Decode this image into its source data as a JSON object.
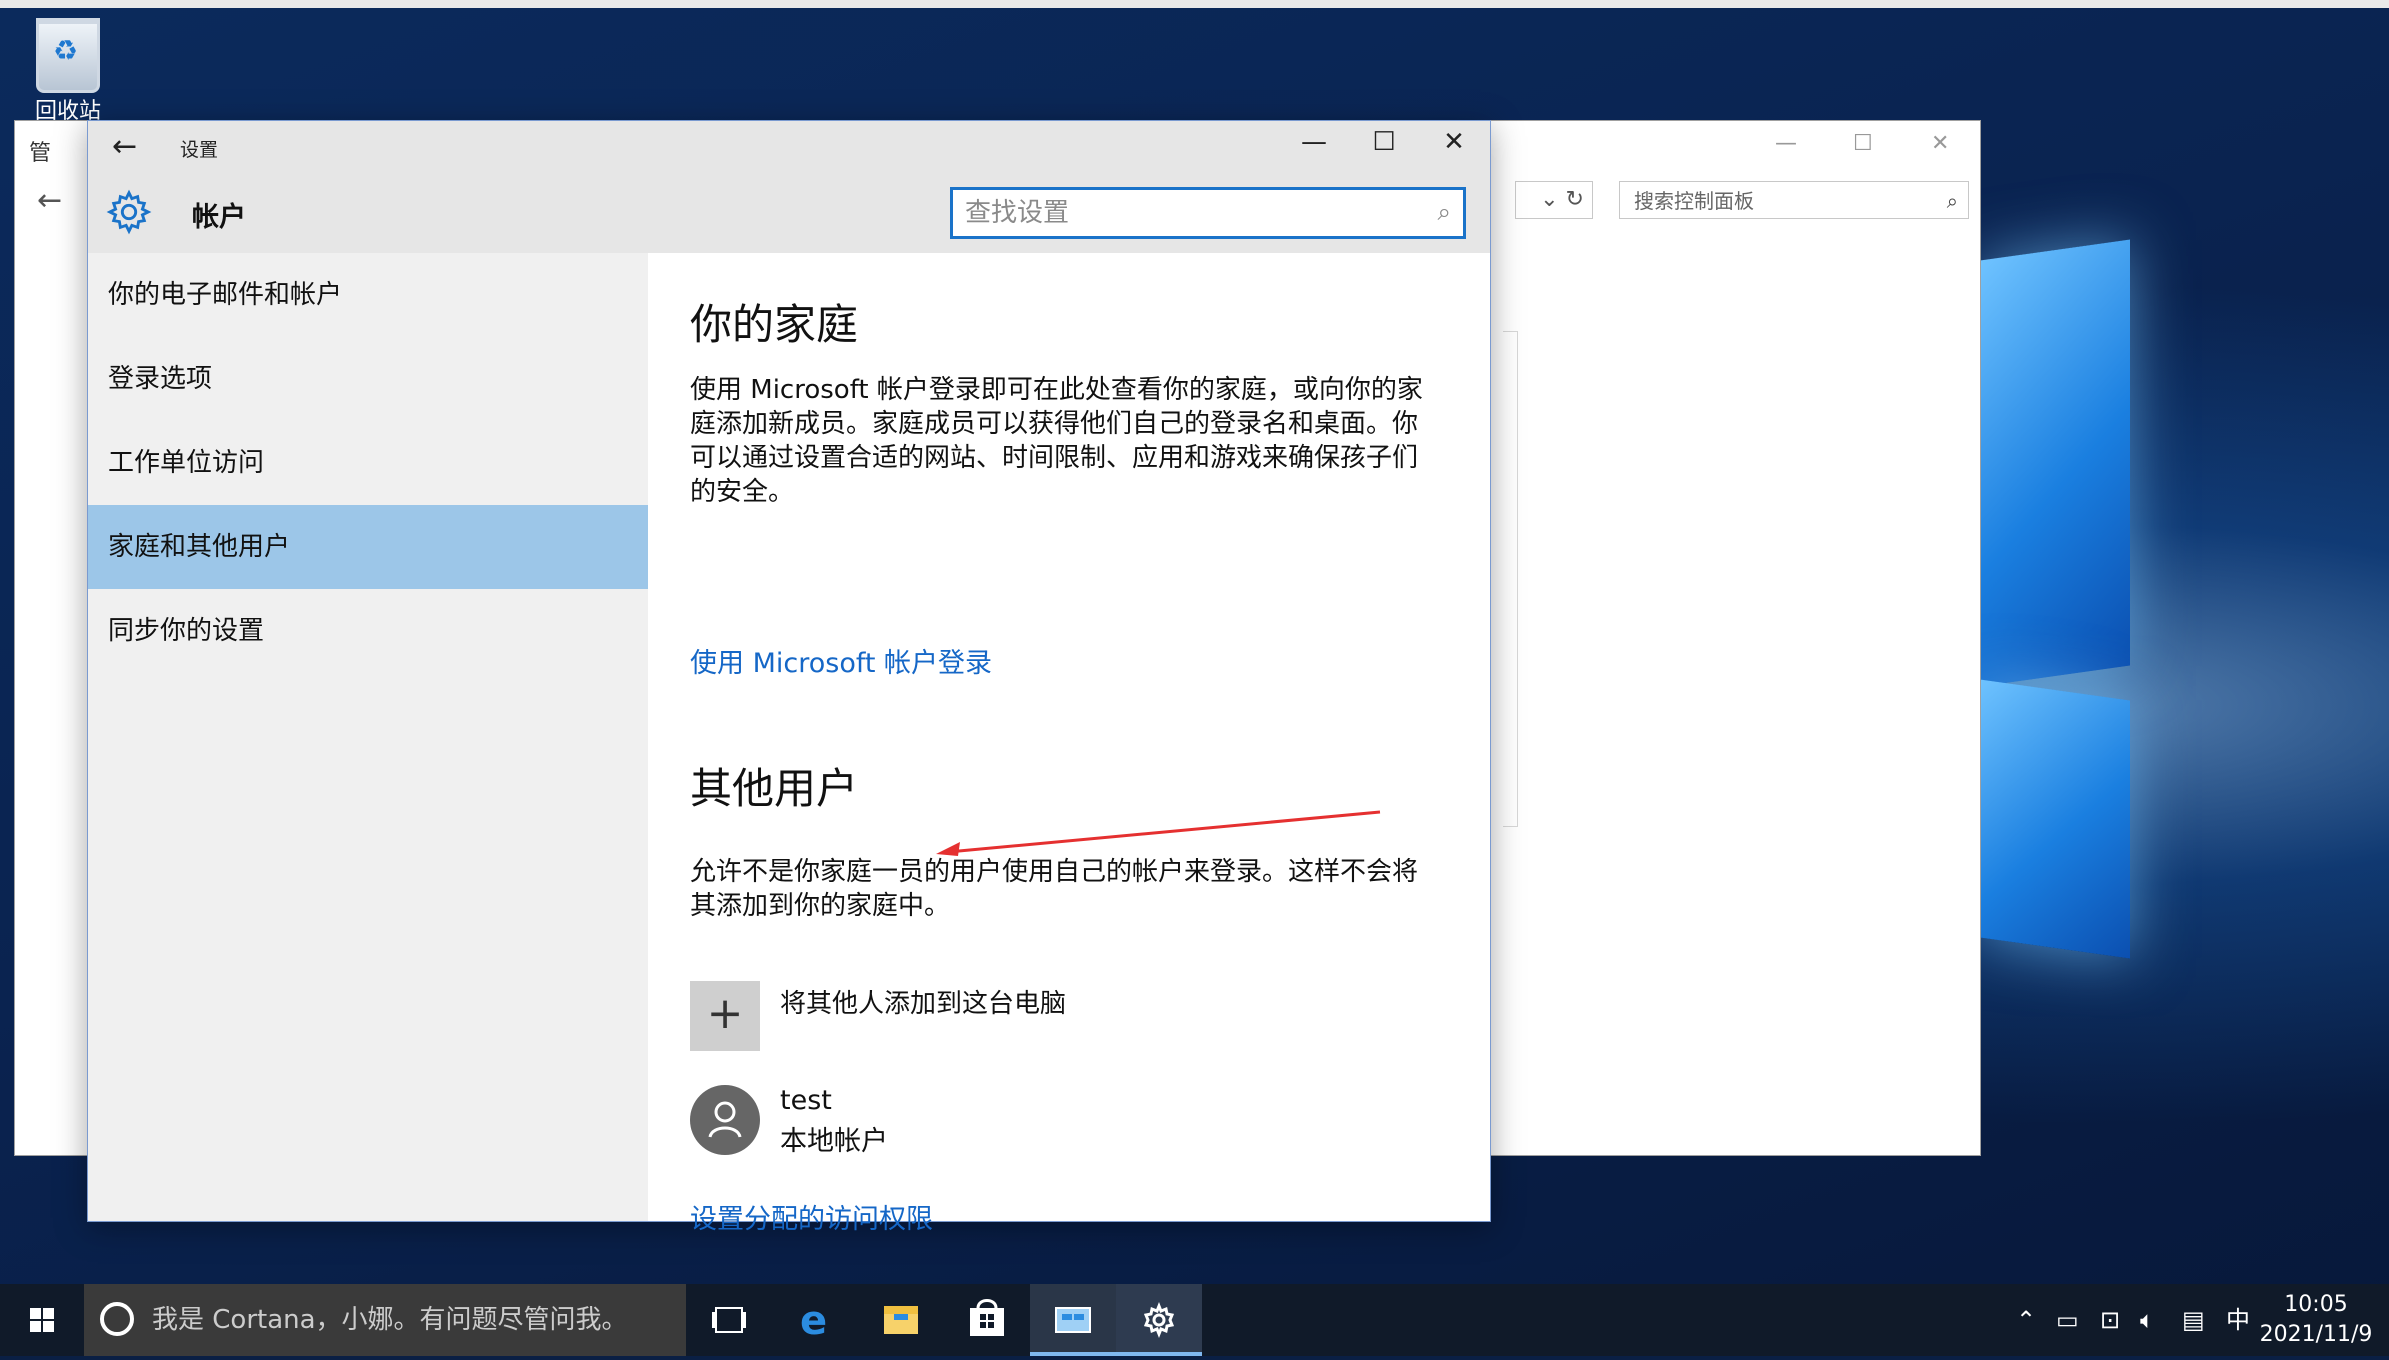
{
  "desktop": {
    "recycle_bin_label": "回收站"
  },
  "control_panel": {
    "title": "管",
    "search_placeholder": "搜索控制面板"
  },
  "settings": {
    "app_title": "设置",
    "header": "帐户",
    "search_placeholder": "查找设置",
    "nav": [
      {
        "label": "你的电子邮件和帐户",
        "active": false
      },
      {
        "label": "登录选项",
        "active": false
      },
      {
        "label": "工作单位访问",
        "active": false
      },
      {
        "label": "家庭和其他用户",
        "active": true
      },
      {
        "label": "同步你的设置",
        "active": false
      }
    ],
    "family": {
      "heading": "你的家庭",
      "line1": "使用 Microsoft 帐户登录即可在此处查看你的家庭，或向你的家",
      "line2": "庭添加新成员。家庭成员可以获得他们自己的登录名和桌面。你",
      "line3": "可以通过设置合适的网站、时间限制、应用和游戏来确保孩子们",
      "line4": "的安全。",
      "link": "使用 Microsoft 帐户登录"
    },
    "others": {
      "heading": "其他用户",
      "line1": "允许不是你家庭一员的用户使用自己的帐户来登录。这样不会将",
      "line2": "其添加到你的家庭中。",
      "add_label": "将其他人添加到这台电脑",
      "user_name": "test",
      "user_type": "本地帐户",
      "access_link": "设置分配的访问权限"
    }
  },
  "taskbar": {
    "cortana_text": "我是 Cortana，小娜。有问题尽管问我。",
    "ime": "中",
    "time": "10:05",
    "date": "2021/11/9"
  },
  "colors": {
    "accent": "#1567c7",
    "nav_active": "#9cc6e8",
    "taskbar": "#101a29"
  }
}
